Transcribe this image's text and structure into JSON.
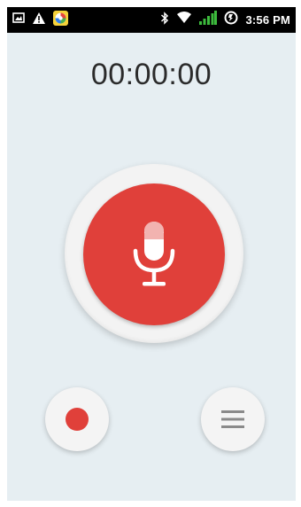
{
  "status_bar": {
    "icons_left": [
      "image-notification-icon",
      "warning-icon",
      "app-notification-icon"
    ],
    "icons_right": [
      "bluetooth-icon",
      "wifi-icon",
      "signal-icon",
      "data-sync-icon"
    ],
    "time": "3:56 PM"
  },
  "recorder": {
    "timer": "00:00:00",
    "mic_button": {
      "icon": "microphone-icon"
    },
    "record_button": {
      "icon": "record-dot-icon"
    },
    "list_button": {
      "icon": "list-icon"
    }
  },
  "colors": {
    "accent_red": "#e0403a",
    "background": "#e6eef2",
    "signal_green": "#3dbb3d"
  }
}
